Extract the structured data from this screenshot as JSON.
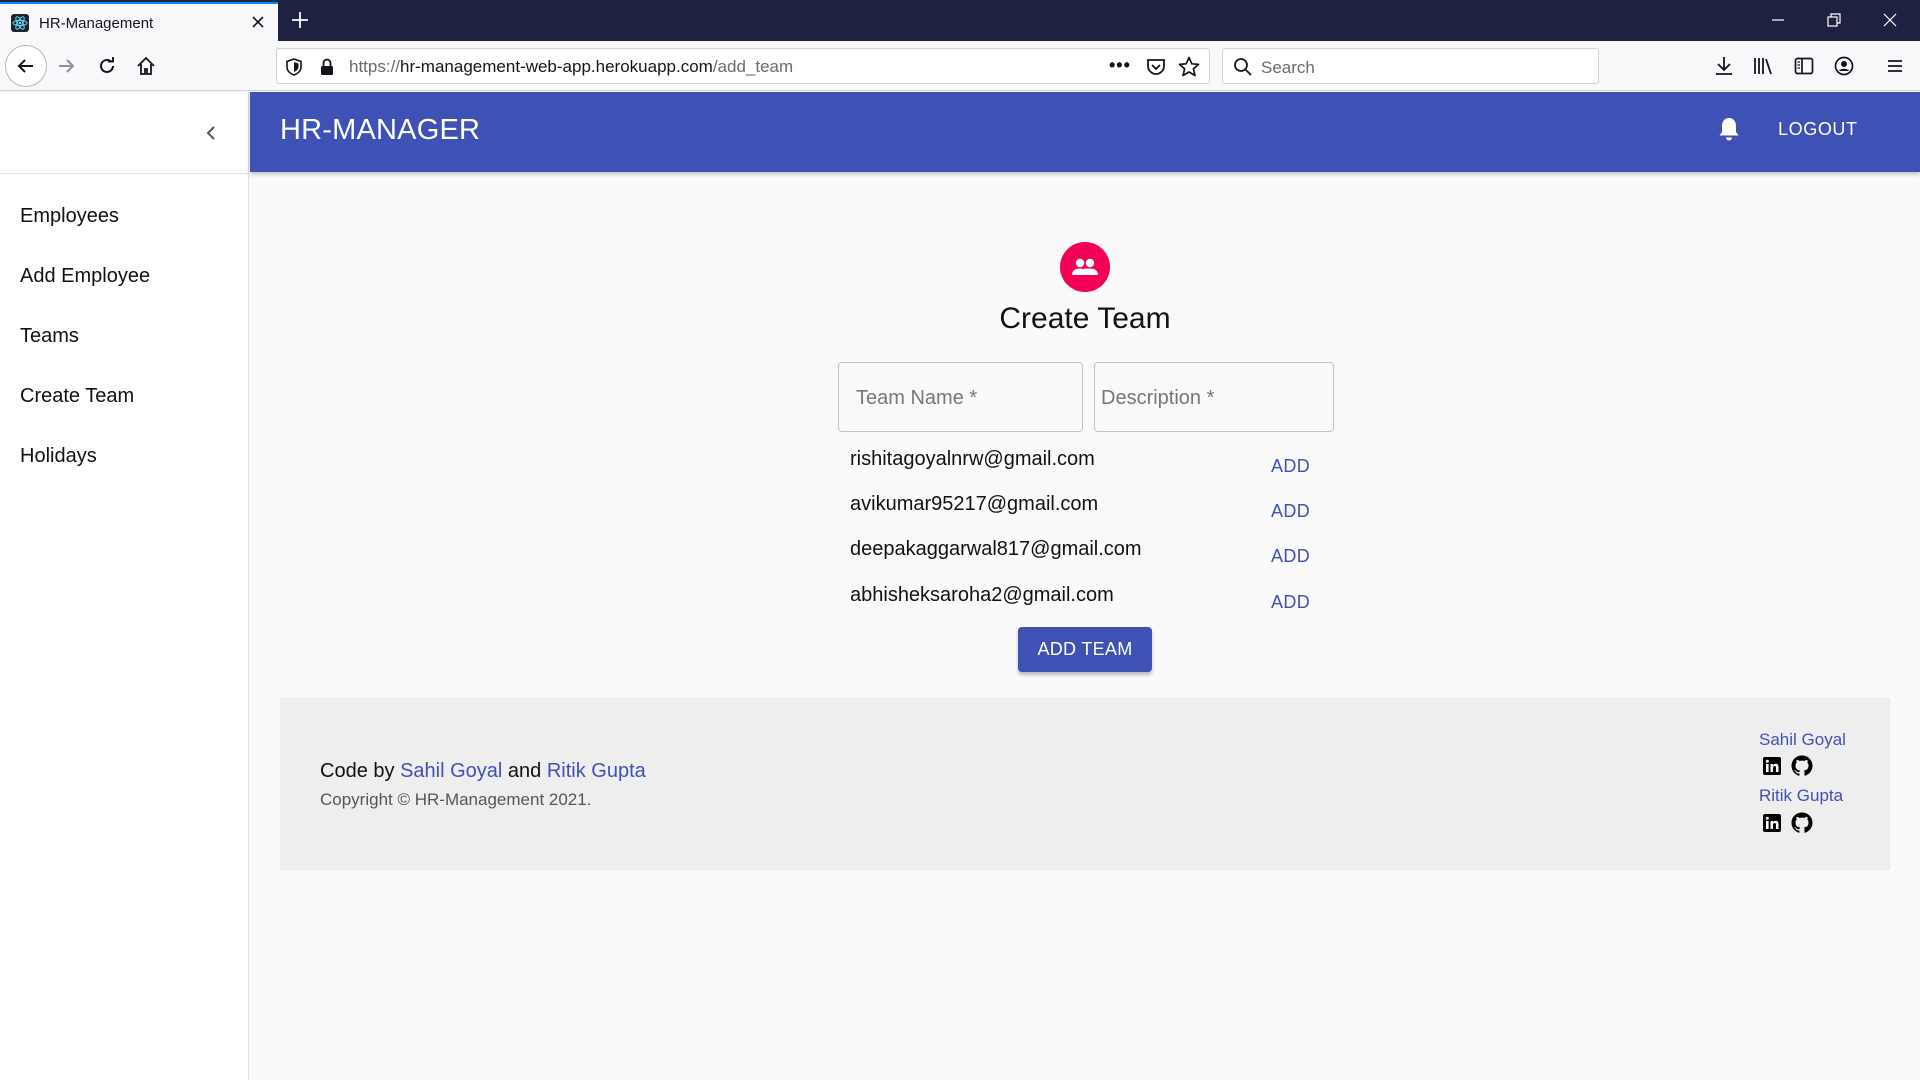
{
  "browser": {
    "tab_title": "HR-Management",
    "url_prefix": "https://",
    "url_host": "hr-management-web-app.herokuapp.com",
    "url_path": "/add_team",
    "url_meatball": "•••",
    "search_placeholder": "Search"
  },
  "sidebar": {
    "items": [
      {
        "label": "Employees"
      },
      {
        "label": "Add Employee"
      },
      {
        "label": "Teams"
      },
      {
        "label": "Create Team"
      },
      {
        "label": "Holidays"
      }
    ]
  },
  "appbar": {
    "title": "HR-MANAGER",
    "logout_label": "LOGOUT",
    "color": "#3f51b5"
  },
  "form": {
    "title": "Create Team",
    "team_name_label": "Team Name *",
    "description_label": "Description *",
    "avatar_color": "#f50057",
    "employees": [
      {
        "email": "rishitagoyalnrw@gmail.com",
        "action": "ADD"
      },
      {
        "email": "avikumar95217@gmail.com",
        "action": "ADD"
      },
      {
        "email": "deepakaggarwal817@gmail.com",
        "action": "ADD"
      },
      {
        "email": "abhisheksaroha2@gmail.com",
        "action": "ADD"
      }
    ],
    "submit_label": "ADD TEAM"
  },
  "footer": {
    "code_by": "Code by",
    "author1": "Sahil Goyal",
    "and": "and",
    "author2": "Ritik Gupta",
    "copyright": "Copyright © HR-Management 2021.",
    "links": [
      {
        "name": "Sahil Goyal",
        "icons": [
          "linkedin-icon",
          "github-icon"
        ]
      },
      {
        "name": "Ritik Gupta",
        "icons": [
          "linkedin-icon",
          "github-icon"
        ]
      }
    ]
  }
}
